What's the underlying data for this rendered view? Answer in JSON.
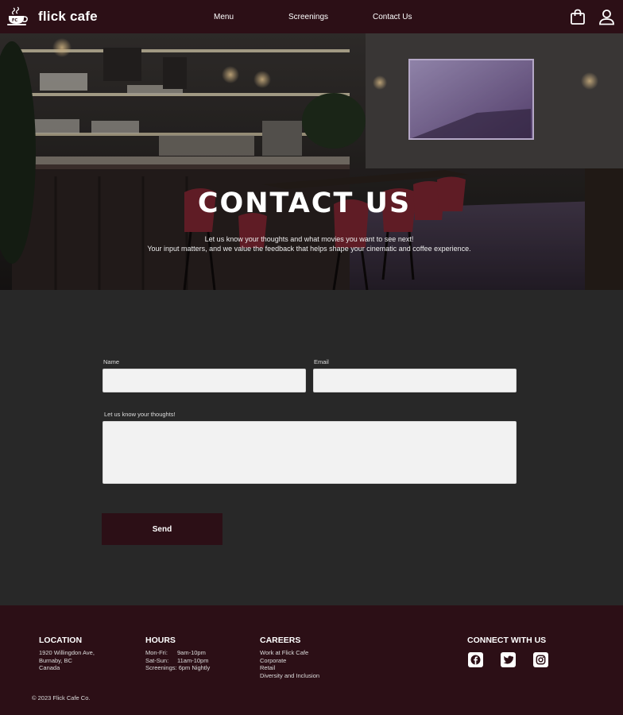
{
  "header": {
    "brand": "flick cafe",
    "nav": [
      "Menu",
      "Screenings",
      "Contact Us"
    ]
  },
  "hero": {
    "title": "CONTACT US",
    "subtitle_line1": "Let us know your thoughts and what movies you want to see next!",
    "subtitle_line2": "Your input matters, and we value the feedback that helps shape your cinematic and coffee experience."
  },
  "form": {
    "name_label": "Name",
    "name_value": "",
    "email_label": "Email",
    "email_value": "",
    "message_label": "Let us know your thoughts!",
    "message_value": "",
    "send_label": "Send"
  },
  "footer": {
    "location": {
      "heading": "LOCATION",
      "lines": [
        "1920 Willingdon Ave,",
        "Burnaby, BC",
        "Canada"
      ]
    },
    "hours": {
      "heading": "HOURS",
      "rows": [
        {
          "label": "Mon-Fri:",
          "value": "9am-10pm"
        },
        {
          "label": "Sat-Sun:",
          "value": "11am-10pm"
        }
      ],
      "screenings": "Screenings: 6pm Nightly"
    },
    "careers": {
      "heading": "CAREERS",
      "links": [
        "Work at Flick Cafe",
        "Corporate",
        "Retail",
        "Diversity and Inclusion"
      ]
    },
    "connect": {
      "heading": "CONNECT WITH US",
      "icons": [
        "facebook-icon",
        "twitter-icon",
        "instagram-icon"
      ]
    },
    "copyright": "© 2023 Flick Cafe Co."
  },
  "colors": {
    "brand_dark": "#2c0f16",
    "page_bg": "#282828",
    "field_bg": "#f2f2f2"
  }
}
